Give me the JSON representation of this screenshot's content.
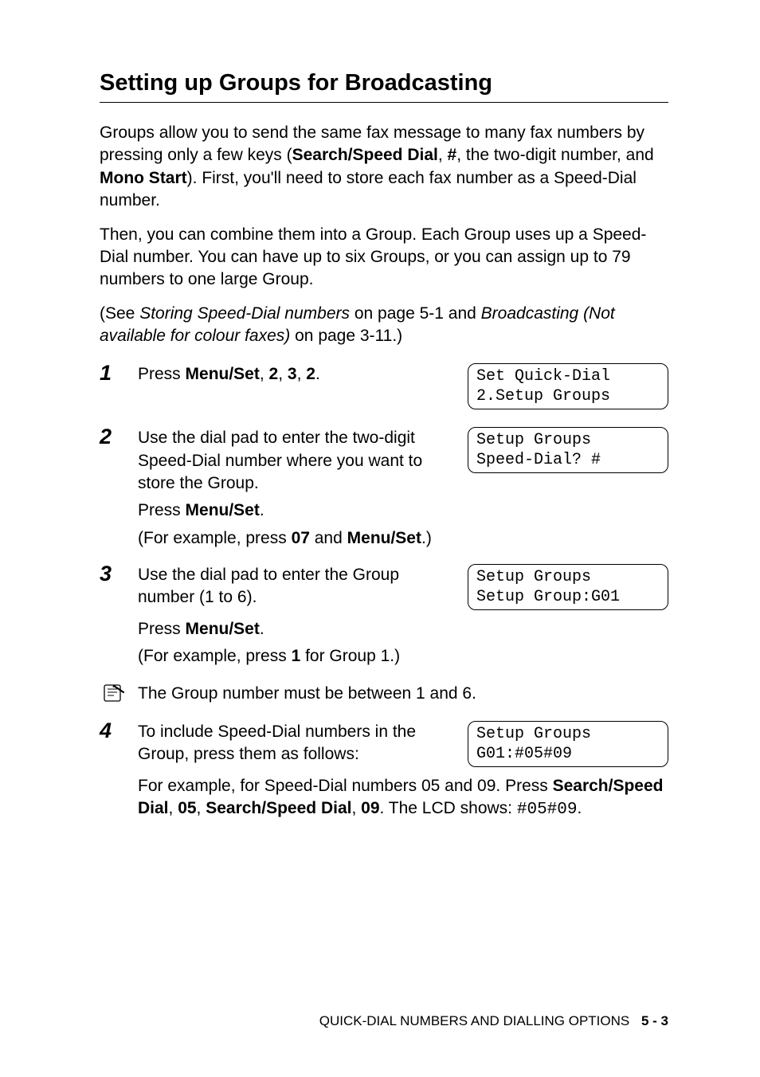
{
  "heading": "Setting up Groups for Broadcasting",
  "intro": {
    "p1_a": "Groups allow you to send the same fax message to many fax numbers by pressing only a few keys (",
    "p1_b1": "Search/Speed Dial",
    "p1_c": ", ",
    "p1_b2": "#",
    "p1_d": ", the two-digit number, and ",
    "p1_b3": "Mono Start",
    "p1_e": "). First, you'll need to store each fax number as a Speed-Dial number.",
    "p2": "Then, you can combine them into a Group. Each Group uses up a Speed-Dial number. You can have up to six Groups, or you can assign up to 79 numbers to one large Group.",
    "p3_a": "(See ",
    "p3_i1": "Storing Speed-Dial numbers",
    "p3_b": " on page 5-1 and ",
    "p3_i2": "Broadcasting (Not available for colour faxes)",
    "p3_c": " on page 3-11.)"
  },
  "steps": {
    "s1": {
      "num": "1",
      "a": "Press ",
      "b1": "Menu/Set",
      "c1": ", ",
      "b2": "2",
      "c2": ", ",
      "b3": "3",
      "c3": ", ",
      "b4": "2",
      "c4": ".",
      "lcd_l1": "Set Quick-Dial",
      "lcd_l2": "2.Setup Groups"
    },
    "s2": {
      "num": "2",
      "p1": "Use the dial pad to enter the two-digit Speed-Dial number where you want to store the Group.",
      "p2_a": "Press ",
      "p2_b": "Menu/Set",
      "p2_c": ".",
      "p3_a": "(For example, press ",
      "p3_b1": "07",
      "p3_c": " and ",
      "p3_b2": "Menu/Set",
      "p3_d": ".)",
      "lcd_l1": "Setup Groups",
      "lcd_l2": "Speed-Dial? #"
    },
    "s3": {
      "num": "3",
      "p1": "Use the dial pad to enter the Group number (1 to 6).",
      "p2_a": "Press ",
      "p2_b": "Menu/Set",
      "p2_c": ".",
      "p3_a": "(For example, press ",
      "p3_b": "1",
      "p3_c": " for Group 1.)",
      "lcd_l1": "Setup Groups",
      "lcd_l2": "Setup Group:G01"
    },
    "note": "The Group number must be between 1 and 6.",
    "s4": {
      "num": "4",
      "p1": "To include Speed-Dial numbers in the Group, press them as follows:",
      "p2_a": "For example, for Speed-Dial numbers 05 and 09. Press ",
      "p2_b1": "Search/Speed Dial",
      "p2_c1": ", ",
      "p2_b2": "05",
      "p2_c2": ", ",
      "p2_b3": "Search/Speed Dial",
      "p2_c3": ", ",
      "p2_b4": "09",
      "p2_c4": ". The LCD shows: ",
      "p2_m": "#05#09",
      "p2_c5": ".",
      "lcd_l1": "Setup Groups",
      "lcd_l2": "G01:#05#09"
    }
  },
  "footer": {
    "chapter": "QUICK-DIAL NUMBERS AND DIALLING OPTIONS",
    "page": "5 - 3"
  }
}
